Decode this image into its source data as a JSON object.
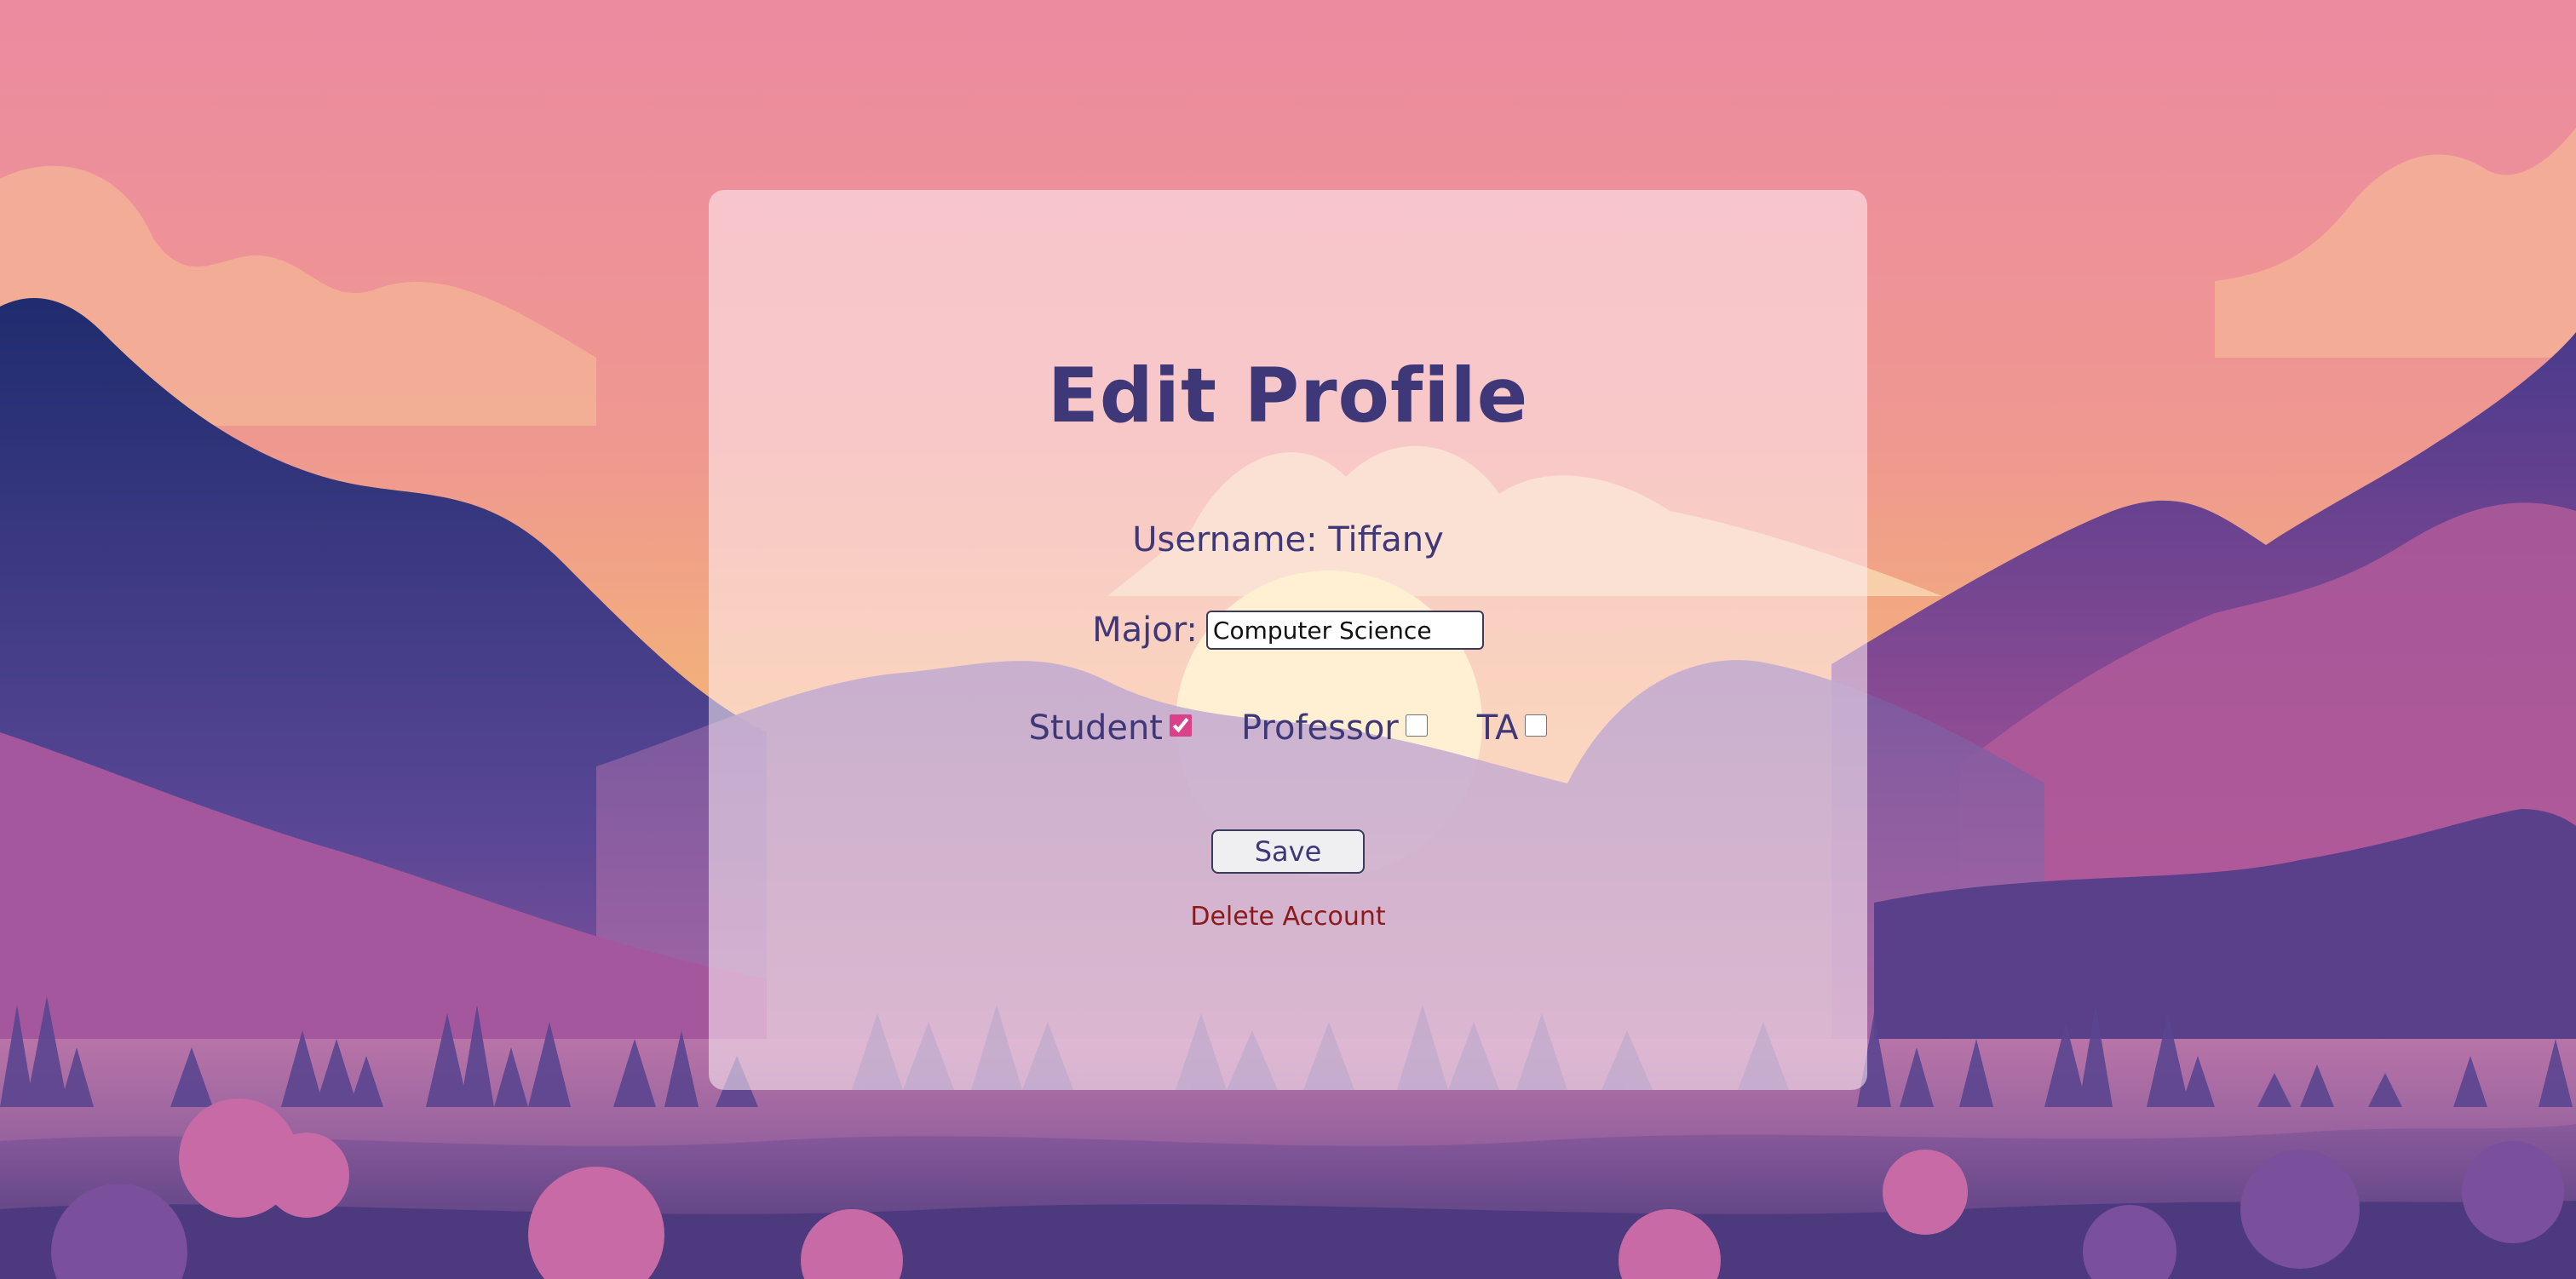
{
  "page": {
    "title": "Edit Profile",
    "username_text": "Username: Tiffany",
    "major_label": "Major:",
    "major_value": "Computer Science",
    "roles": [
      {
        "label": "Student",
        "checked": true
      },
      {
        "label": "Professor",
        "checked": false
      },
      {
        "label": "TA",
        "checked": false
      }
    ],
    "save_label": "Save",
    "delete_label": "Delete Account"
  },
  "colors": {
    "heading": "#3f3878",
    "delete_link": "#8b1a1a",
    "checkbox_accent": "#d9428a",
    "sky_top": "#ec8aa0",
    "sky_mid": "#f2a37c",
    "sun": "#fff0a8"
  }
}
